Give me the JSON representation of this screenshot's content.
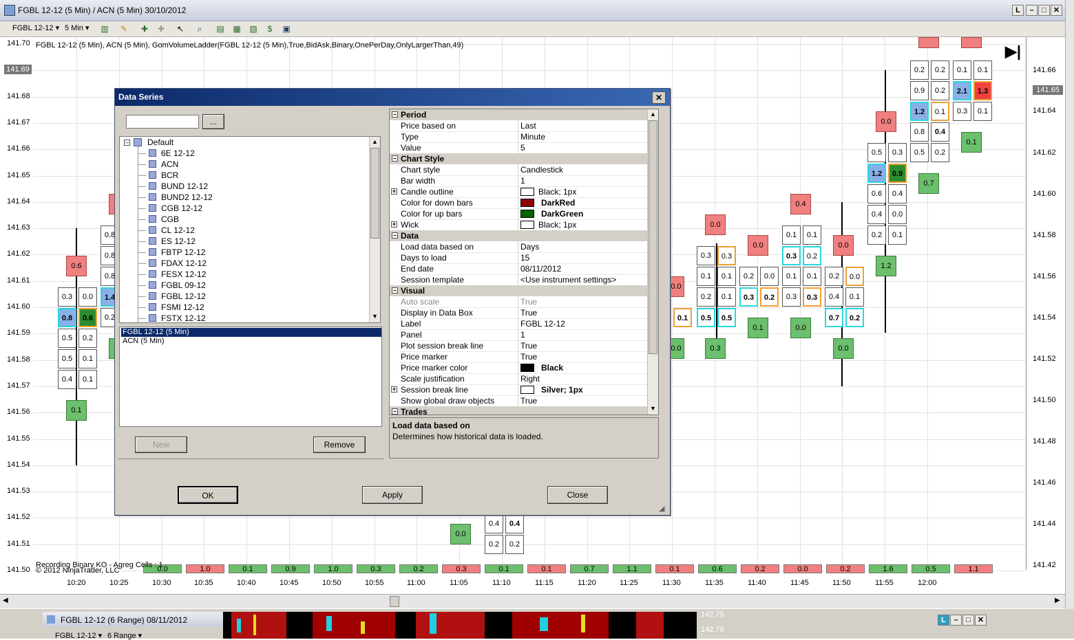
{
  "window": {
    "title": "FGBL 12-12 (5 Min) / ACN (5 Min)  30/10/2012",
    "buttons": [
      "L",
      "–",
      "□",
      "✕"
    ]
  },
  "toolbar": {
    "instrument": "FGBL 12-12",
    "interval": "5 Min"
  },
  "chart": {
    "header": "FGBL 12-12 (5 Min), ACN (5 Min), GomVolumeLadder(FGBL 12-12 (5 Min),True,BidAsk,Binary,OnePerDay,OnlyLargerThan,49)",
    "left_axis": [
      "141.70",
      "141.69",
      "141.68",
      "141.67",
      "141.66",
      "141.65",
      "141.64",
      "141.63",
      "141.62",
      "141.61",
      "141.60",
      "141.59",
      "141.58",
      "141.57",
      "141.56",
      "141.55",
      "141.54",
      "141.53",
      "141.52",
      "141.51",
      "141.50"
    ],
    "right_axis": [
      "141.66",
      "141.65",
      "141.64",
      "141.62",
      "141.60",
      "141.58",
      "141.56",
      "141.54",
      "141.52",
      "141.50",
      "141.48",
      "141.46",
      "141.44",
      "141.42"
    ],
    "left_price_marker": "141.69",
    "right_price_marker": "141.65",
    "time_axis": [
      "10:20",
      "10:25",
      "10:30",
      "10:35",
      "10:40",
      "10:45",
      "10:50",
      "10:55",
      "11:00",
      "11:05",
      "11:10",
      "11:15",
      "11:20",
      "11:25",
      "11:30",
      "11:35",
      "11:40",
      "11:45",
      "11:50",
      "11:55",
      "12:00"
    ],
    "footer_line1": "Recording Binary KO - Agreg Cells : 1",
    "footer_line2": "© 2012 NinjaTrader, LLC",
    "strip_values": [
      {
        "v": "0.0",
        "c": "green"
      },
      {
        "v": "1.0",
        "c": "red"
      },
      {
        "v": "0.1",
        "c": "green"
      },
      {
        "v": "0.9",
        "c": "green"
      },
      {
        "v": "1.0",
        "c": "green"
      },
      {
        "v": "0.3",
        "c": "green"
      },
      {
        "v": "0.2",
        "c": "green"
      },
      {
        "v": "0.3",
        "c": "red"
      },
      {
        "v": "0.1",
        "c": "green"
      },
      {
        "v": "0.1",
        "c": "red"
      },
      {
        "v": "0.7",
        "c": "green"
      },
      {
        "v": "1.1",
        "c": "green"
      },
      {
        "v": "0.1",
        "c": "red"
      },
      {
        "v": "0.6",
        "c": "green"
      },
      {
        "v": "0.2",
        "c": "red"
      },
      {
        "v": "0.0",
        "c": "red"
      },
      {
        "v": "0.2",
        "c": "red"
      },
      {
        "v": "1.6",
        "c": "green"
      },
      {
        "v": "0.5",
        "c": "green"
      },
      {
        "v": "1.1",
        "c": "red"
      }
    ]
  },
  "dialog": {
    "title": "Data Series",
    "search_value": "",
    "browse_label": "...",
    "tree_root": "Default",
    "instruments": [
      "6E 12-12",
      "ACN",
      "BCR",
      "BUND 12-12",
      "BUND2 12-12",
      "CGB 12-12",
      "CGB",
      "CL 12-12",
      "ES 12-12",
      "FBTP 12-12",
      "FDAX 12-12",
      "FESX 12-12",
      "FGBL 09-12",
      "FGBL 12-12",
      "FSMI 12-12",
      "FSTX 12-12"
    ],
    "series": [
      "FGBL 12-12 (5 Min)",
      "ACN (5 Min)"
    ],
    "new_label": "New",
    "remove_label": "Remove",
    "ok_label": "OK",
    "apply_label": "Apply",
    "close_label": "Close",
    "help_title": "Load data based on",
    "help_text": "Determines how historical data is loaded.",
    "properties": {
      "period": {
        "label": "Period",
        "rows": [
          {
            "n": "Price based on",
            "v": "Last"
          },
          {
            "n": "Type",
            "v": "Minute"
          },
          {
            "n": "Value",
            "v": "5"
          }
        ]
      },
      "chart_style": {
        "label": "Chart Style",
        "rows": [
          {
            "n": "Chart style",
            "v": "Candlestick"
          },
          {
            "n": "Bar width",
            "v": "1"
          },
          {
            "n": "Candle outline",
            "v": "Black; 1px"
          },
          {
            "n": "Color for down bars",
            "v": "DarkRed"
          },
          {
            "n": "Color for up bars",
            "v": "DarkGreen"
          },
          {
            "n": "Wick",
            "v": "Black; 1px"
          }
        ]
      },
      "data": {
        "label": "Data",
        "rows": [
          {
            "n": "Load data based on",
            "v": "Days"
          },
          {
            "n": "Days to load",
            "v": "15"
          },
          {
            "n": "End date",
            "v": "08/11/2012"
          },
          {
            "n": "Session template",
            "v": "<Use instrument settings>"
          }
        ]
      },
      "visual": {
        "label": "Visual",
        "rows": [
          {
            "n": "Auto scale",
            "v": "True"
          },
          {
            "n": "Display in Data Box",
            "v": "True"
          },
          {
            "n": "Label",
            "v": "FGBL 12-12"
          },
          {
            "n": "Panel",
            "v": "1"
          },
          {
            "n": "Plot session break line",
            "v": "True"
          },
          {
            "n": "Price marker",
            "v": "True"
          },
          {
            "n": "Price marker color",
            "v": "Black"
          },
          {
            "n": "Scale justification",
            "v": "Right"
          },
          {
            "n": "Session break line",
            "v": "Silver; 1px"
          },
          {
            "n": "Show global draw objects",
            "v": "True"
          }
        ]
      },
      "trades": {
        "label": "Trades"
      }
    },
    "colors": {
      "darkred": "#8b0000",
      "darkgreen": "#006400",
      "black": "#000000",
      "silver": "#c0c0c0"
    }
  },
  "subwindow": {
    "title": "FGBL 12-12 (6 Range)  08/11/2012",
    "instrument": "FGBL 12-12",
    "interval": "6 Range",
    "price1": "142.75",
    "price2": "142.70"
  }
}
